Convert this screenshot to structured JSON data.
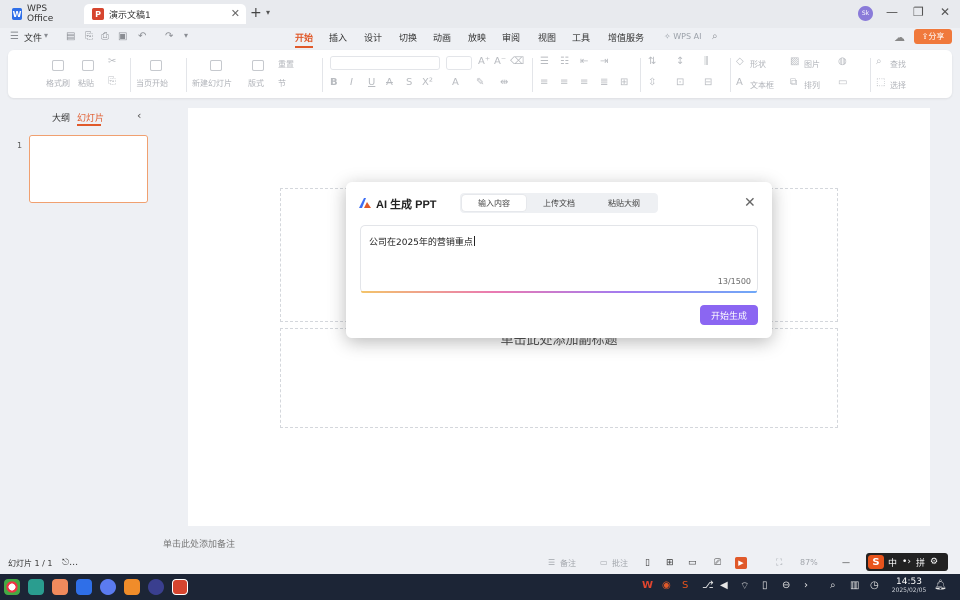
{
  "tabs": [
    {
      "label": "WPS Office",
      "icon": "wps-logo-icon"
    },
    {
      "label": "演示文稿1",
      "icon": "presentation-doc-icon",
      "active": true
    }
  ],
  "menu": {
    "file_label": "文件",
    "items": [
      "开始",
      "插入",
      "设计",
      "切换",
      "动画",
      "放映",
      "审阅",
      "视图",
      "工具",
      "增值服务"
    ],
    "active": "开始",
    "wps_ai_label": "WPS AI",
    "share_label": "分享"
  },
  "ribbon": {
    "format_painter": "格式刷",
    "paste": "粘贴",
    "from_current": "当页开始",
    "new_slide": "新建幻灯片",
    "layout": "版式",
    "section": "节",
    "reset": "重置",
    "shape": "形状",
    "picture": "图片",
    "textbox": "文本框",
    "arrange": "排列",
    "find_replace": "查找",
    "select": "选择"
  },
  "left_panel": {
    "tab_outline": "大纲",
    "tab_slides": "幻灯片",
    "slide_number": "1"
  },
  "canvas": {
    "subtitle_placeholder": "单击此处添加副标题"
  },
  "notes_placeholder": "单击此处添加备注",
  "dialog": {
    "title": "AI 生成 PPT",
    "tabs": [
      "输入内容",
      "上传文档",
      "粘贴大纲"
    ],
    "active_tab": "输入内容",
    "input_value": "公司在2025年的营销重点",
    "counter": "13/1500",
    "generate_button": "开始生成",
    "accent_color": "#8b66f2"
  },
  "status": {
    "slide_indicator": "幻灯片 1 / 1",
    "notes_toggle": "备注",
    "comments_toggle": "批注",
    "zoom": "87%"
  },
  "ime": {
    "mode": "中",
    "pinyin": "拼"
  },
  "taskbar": {
    "time": "14:53",
    "date": "2025/02/05"
  }
}
